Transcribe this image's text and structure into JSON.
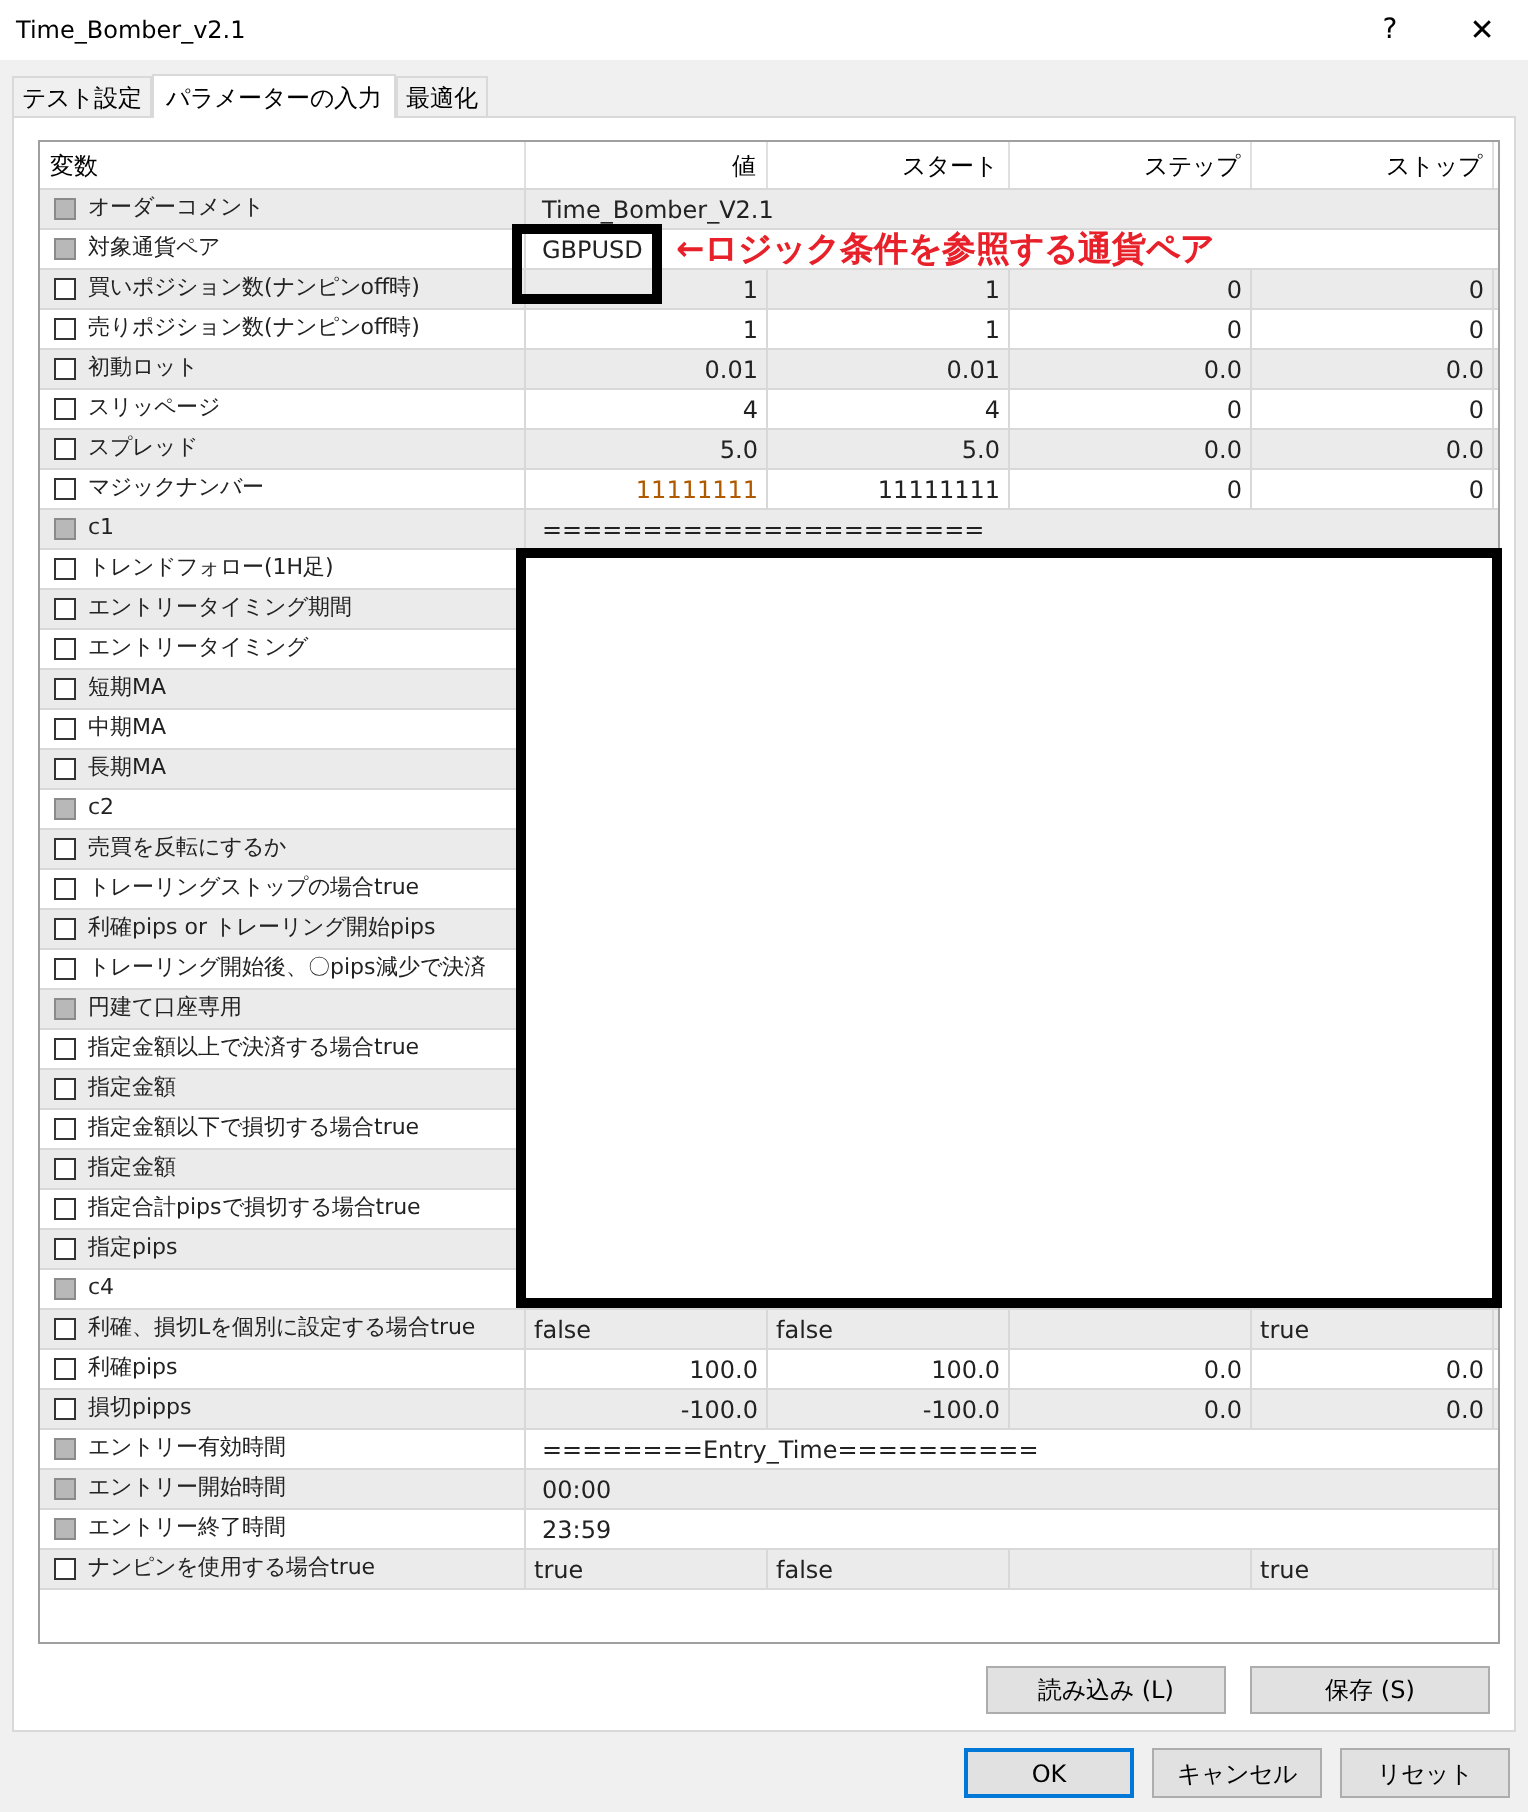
{
  "window": {
    "title": "Time_Bomber_v2.1",
    "help": "?",
    "close": "✕"
  },
  "tabs": [
    {
      "label": "テスト設定",
      "selected": false
    },
    {
      "label": "パラメーターの入力",
      "selected": true
    },
    {
      "label": "最適化",
      "selected": false
    }
  ],
  "columns": [
    "変数",
    "値",
    "スタート",
    "ステップ",
    "ストップ"
  ],
  "callout": "←ロジック条件を参照する通貨ペア",
  "rows": [
    {
      "name": "オーダーコメント",
      "disabled": true,
      "kind": "text",
      "cells": [
        "Time_Bomber_V2.1"
      ]
    },
    {
      "name": "対象通貨ペア",
      "disabled": true,
      "kind": "text",
      "boxed": true,
      "cells": [
        "GBPUSD"
      ]
    },
    {
      "name": "買いポジション数(ナンピンoff時)",
      "disabled": false,
      "kind": "number",
      "modified": false,
      "cells": [
        "1",
        "1",
        "0",
        "0"
      ]
    },
    {
      "name": "売りポジション数(ナンピンoff時)",
      "disabled": false,
      "kind": "number",
      "modified": false,
      "cells": [
        "1",
        "1",
        "0",
        "0"
      ]
    },
    {
      "name": "初動ロット",
      "disabled": false,
      "kind": "number",
      "modified": false,
      "cells": [
        "0.01",
        "0.01",
        "0.0",
        "0.0"
      ]
    },
    {
      "name": "スリッページ",
      "disabled": false,
      "kind": "number",
      "modified": false,
      "cells": [
        "4",
        "4",
        "0",
        "0"
      ]
    },
    {
      "name": "スプレッド",
      "disabled": false,
      "kind": "number",
      "modified": false,
      "cells": [
        "5.0",
        "5.0",
        "0.0",
        "0.0"
      ]
    },
    {
      "name": "マジックナンバー",
      "disabled": false,
      "kind": "number",
      "modified": true,
      "cells": [
        "11111111",
        "11111111",
        "0",
        "0"
      ]
    },
    {
      "name": "c1",
      "disabled": true,
      "kind": "text",
      "cells": [
        "======================"
      ]
    },
    {
      "name": "トレンドフォロー(1H足)",
      "disabled": false,
      "redacted": true
    },
    {
      "name": "エントリータイミング期間",
      "disabled": false,
      "redacted": true
    },
    {
      "name": "エントリータイミング",
      "disabled": false,
      "redacted": true
    },
    {
      "name": "短期MA",
      "disabled": false,
      "redacted": true
    },
    {
      "name": "中期MA",
      "disabled": false,
      "redacted": true
    },
    {
      "name": "長期MA",
      "disabled": false,
      "redacted": true
    },
    {
      "name": "c2",
      "disabled": true,
      "redacted": true
    },
    {
      "name": "売買を反転にするか",
      "disabled": false,
      "redacted": true
    },
    {
      "name": "トレーリングストップの場合true",
      "disabled": false,
      "redacted": true
    },
    {
      "name": "利確pips or トレーリング開始pips",
      "disabled": false,
      "redacted": true
    },
    {
      "name": "トレーリング開始後、〇pips減少で決済",
      "disabled": false,
      "redacted": true
    },
    {
      "name": "円建て口座専用",
      "disabled": true,
      "redacted": true
    },
    {
      "name": "指定金額以上で決済する場合true",
      "disabled": false,
      "redacted": true
    },
    {
      "name": "指定金額",
      "disabled": false,
      "redacted": true
    },
    {
      "name": "指定金額以下で損切する場合true",
      "disabled": false,
      "redacted": true
    },
    {
      "name": "指定金額",
      "disabled": false,
      "redacted": true
    },
    {
      "name": "指定合計pipsで損切する場合true",
      "disabled": false,
      "redacted": true
    },
    {
      "name": "指定pips",
      "disabled": false,
      "redacted": true
    },
    {
      "name": "c4",
      "disabled": true,
      "redacted": true
    },
    {
      "name": "利確、損切Lを個別に設定する場合true",
      "disabled": false,
      "kind": "bool",
      "cells": [
        "false",
        "false",
        "",
        "true"
      ]
    },
    {
      "name": "利確pips",
      "disabled": false,
      "kind": "number",
      "modified": false,
      "cells": [
        "100.0",
        "100.0",
        "0.0",
        "0.0"
      ]
    },
    {
      "name": "損切pipps",
      "disabled": false,
      "kind": "number",
      "modified": false,
      "cells": [
        "-100.0",
        "-100.0",
        "0.0",
        "0.0"
      ]
    },
    {
      "name": "エントリー有効時間",
      "disabled": true,
      "kind": "text",
      "cells": [
        "========Entry_Time=========="
      ]
    },
    {
      "name": "エントリー開始時間",
      "disabled": true,
      "kind": "text",
      "cells": [
        "00:00"
      ]
    },
    {
      "name": "エントリー終了時間",
      "disabled": true,
      "kind": "text",
      "cells": [
        "23:59"
      ]
    },
    {
      "name": "ナンピンを使用する場合true",
      "disabled": false,
      "kind": "bool",
      "cells": [
        "true",
        "false",
        "",
        "true"
      ]
    }
  ],
  "panel_buttons": [
    "読み込み (L)",
    "保存 (S)"
  ],
  "dialog_buttons": [
    {
      "label": "OK",
      "selected": true
    },
    {
      "label": "キャンセル",
      "selected": false
    },
    {
      "label": "リセット",
      "selected": false
    }
  ]
}
